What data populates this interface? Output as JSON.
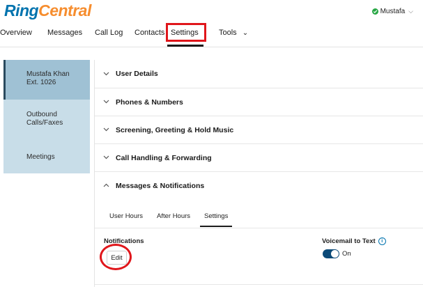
{
  "header": {
    "logo_part1": "Ring",
    "logo_part2": "Central",
    "user_name": "Mustafa",
    "status_color": "#28a745",
    "dropdown_icon": "chevron-down-icon"
  },
  "nav": {
    "items": [
      {
        "label": "Overview"
      },
      {
        "label": "Messages"
      },
      {
        "label": "Call Log"
      },
      {
        "label": "Contacts"
      },
      {
        "label": "Settings",
        "active": true
      },
      {
        "label": "Tools"
      }
    ],
    "tools_chevron": "⌄"
  },
  "sidebar": {
    "user_name": "Mustafa Khan",
    "extension": "Ext. 1026",
    "items": [
      {
        "label_line1": "Outbound",
        "label_line2": "Calls/Faxes"
      },
      {
        "label_line1": "Meetings",
        "label_line2": ""
      }
    ]
  },
  "accordion": {
    "sections": [
      {
        "title": "User Details",
        "expanded": false
      },
      {
        "title": "Phones & Numbers",
        "expanded": false
      },
      {
        "title": "Screening, Greeting & Hold Music",
        "expanded": false
      },
      {
        "title": "Call Handling & Forwarding",
        "expanded": false
      },
      {
        "title": "Messages & Notifications",
        "expanded": true
      }
    ],
    "collapsed_icon": "chevron-down-icon",
    "expanded_icon": "chevron-up-icon"
  },
  "messages_notifications": {
    "subtabs": [
      {
        "label": "User Hours"
      },
      {
        "label": "After Hours"
      },
      {
        "label": "Settings",
        "active": true
      }
    ],
    "notifications_label": "Notifications",
    "edit_label": "Edit",
    "voicemail_to_text_label": "Voicemail to Text",
    "voicemail_to_text_state": "On",
    "info_icon": "i"
  },
  "colors": {
    "brand_blue": "#0073ae",
    "brand_orange": "#f68d2e",
    "highlight_red": "#e0161b",
    "toggle_on": "#0b4a78"
  }
}
